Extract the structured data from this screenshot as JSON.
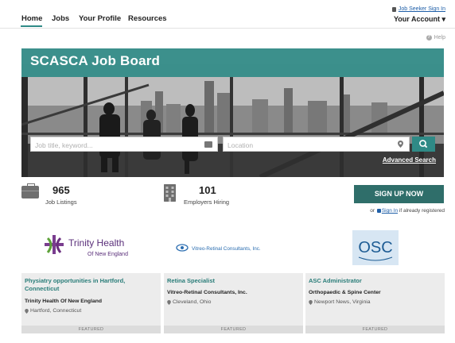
{
  "nav": {
    "home": "Home",
    "jobs": "Jobs",
    "profile": "Your Profile",
    "resources": "Resources",
    "signin": "Job Seeker Sign In",
    "account": "Your Account ▾",
    "help": "Help"
  },
  "hero": {
    "title": "SCASCA Job Board",
    "keyword_placeholder": "Job title, keyword...",
    "location_placeholder": "Location",
    "advanced_search": "Advanced Search"
  },
  "stats": {
    "listings_count": "965",
    "listings_label": "Job Listings",
    "employers_count": "101",
    "employers_label": "Employers Hiring"
  },
  "signup": {
    "button": "SIGN UP NOW",
    "prefix": "or",
    "link": "Sign In",
    "suffix": "if already registered"
  },
  "logos": {
    "trinity_line1": "Trinity Health",
    "trinity_line2": "Of New England",
    "vitreo": "Vitreo-Retinal Consultants, Inc.",
    "osc": "OSC"
  },
  "jobs": [
    {
      "title": "Physiatry opportunities in Hartford, Connecticut",
      "company": "Trinity Health Of New England",
      "location": "Hartford, Connecticut",
      "badge": "FEATURED"
    },
    {
      "title": "Retina Specialist",
      "company": "Vitreo-Retinal Consultants, Inc.",
      "location": "Cleveland, Ohio",
      "badge": "FEATURED"
    },
    {
      "title": "ASC Administrator",
      "company": "Orthopaedic & Spine Center",
      "location": "Newport News, Virginia",
      "badge": "FEATURED"
    }
  ],
  "colors": {
    "accent": "#2f8a86",
    "signup": "#2f6e6a",
    "link": "#1f5fa8"
  }
}
